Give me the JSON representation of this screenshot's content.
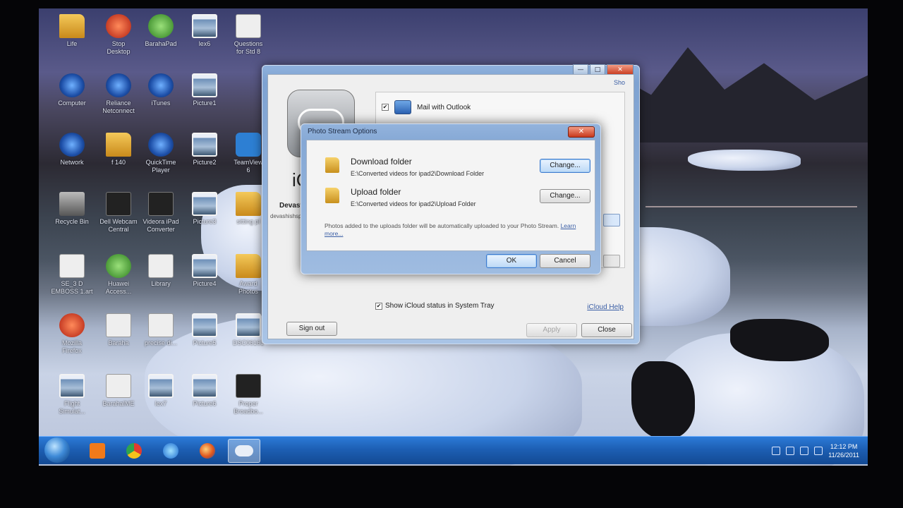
{
  "desktop": {
    "icons": [
      {
        "label": "Life",
        "kind": "folder"
      },
      {
        "label": "Stop\nDesktop",
        "kind": "red"
      },
      {
        "label": "BarahaPad",
        "kind": "green"
      },
      {
        "label": "lex6",
        "kind": "pic"
      },
      {
        "label": "Questions\nfor Std 8",
        "kind": "doc"
      },
      {
        "label": "Computer",
        "kind": "blue"
      },
      {
        "label": "Reliance\nNetconnect",
        "kind": "blue"
      },
      {
        "label": "iTunes",
        "kind": "blue"
      },
      {
        "label": "Picture1",
        "kind": "pic"
      },
      {
        "label": "Network",
        "kind": "blue"
      },
      {
        "label": "f 140",
        "kind": "folder"
      },
      {
        "label": "QuickTime\nPlayer",
        "kind": "blue"
      },
      {
        "label": "Picture2",
        "kind": "pic"
      },
      {
        "label": "TeamView\n6",
        "kind": "teal"
      },
      {
        "label": "Recycle Bin",
        "kind": "grey"
      },
      {
        "label": "Dell Webcam\nCentral",
        "kind": "dark"
      },
      {
        "label": "Videora iPad\nConverter",
        "kind": "dark"
      },
      {
        "label": "Picture3",
        "kind": "pic"
      },
      {
        "label": "sitting pl",
        "kind": "folder"
      },
      {
        "label": "SE_3 D\nEMBOSS 1.art",
        "kind": "doc"
      },
      {
        "label": "Huawei\nAccess...",
        "kind": "green"
      },
      {
        "label": "Library",
        "kind": "doc"
      },
      {
        "label": "Picture4",
        "kind": "pic"
      },
      {
        "label": "Award\nPhotos",
        "kind": "folder"
      },
      {
        "label": "Mozilla\nFirefox",
        "kind": "red"
      },
      {
        "label": "Baraha",
        "kind": "doc"
      },
      {
        "label": "precise di...",
        "kind": "doc"
      },
      {
        "label": "Picture5",
        "kind": "pic"
      },
      {
        "label": "DSC06161",
        "kind": "pic"
      },
      {
        "label": "Flight\nSimulat...",
        "kind": "pic"
      },
      {
        "label": "BarahaIME",
        "kind": "doc"
      },
      {
        "label": "lex7",
        "kind": "pic"
      },
      {
        "label": "Picture6",
        "kind": "pic"
      },
      {
        "label": "Proper\nBroadbo...",
        "kind": "dark"
      }
    ]
  },
  "taskbar": {
    "clock_time": "12:12 PM",
    "clock_date": "11/26/2011",
    "buttons": [
      "start",
      "media-player",
      "chrome",
      "internet-explorer",
      "firefox",
      "icloud"
    ]
  },
  "icloud_window": {
    "title_buttons": [
      "—",
      "□",
      "✕"
    ],
    "brand_fragment": "iC",
    "user_name": "Devast",
    "user_email": "devashishsp",
    "account_link": "Sho",
    "services": [
      {
        "label": "Mail with Outlook",
        "checked": true
      }
    ],
    "tray_option_label": "Show iCloud status in System Tray",
    "tray_option_checked": true,
    "help_link": "iCloud Help",
    "sign_out": "Sign out",
    "apply": "Apply",
    "close": "Close"
  },
  "photo_stream_dialog": {
    "title": "Photo Stream Options",
    "close_glyph": "✕",
    "download_label": "Download folder",
    "download_path": "E:\\Converted videos for ipad2\\Download Folder",
    "upload_label": "Upload folder",
    "upload_path": "E:\\Converted videos for ipad2\\Upload Folder",
    "change_label": "Change...",
    "note": "Photos added to the uploads folder will be automatically uploaded to your Photo Stream.",
    "learn_more": "Learn more...",
    "ok": "OK",
    "cancel": "Cancel"
  }
}
